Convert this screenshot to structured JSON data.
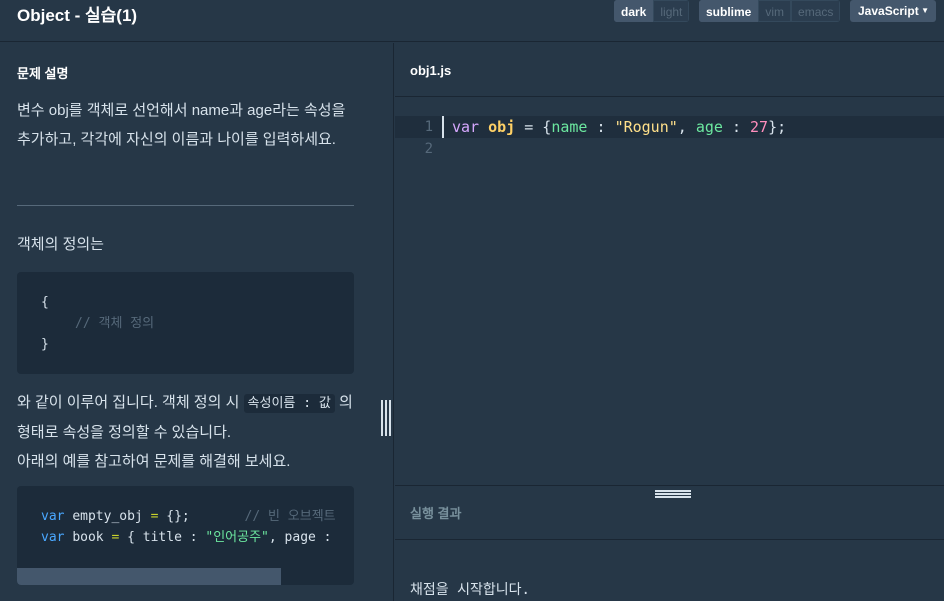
{
  "header": {
    "title": "Object - 실습(1)",
    "theme": [
      "dark",
      "light"
    ],
    "keymap": [
      "sublime",
      "vim",
      "emacs"
    ],
    "language": "JavaScript"
  },
  "problem": {
    "heading": "문제 설명",
    "description": "변수 obj를 객체로 선언해서 name과 age라는 속성을 추가하고, 각각에 자신의 이름과 나이를 입력하세요.",
    "definition_intro": "객체의 정의는",
    "code1": {
      "open": "{",
      "comment": "// 객체 정의",
      "close": "}"
    },
    "p2_prefix": "와 같이 이루어 집니다. 객체 정의 시",
    "p2_code": "속성이름 : 값",
    "p2_suffix": "의 형태로 속성을 정의할 수 있습니다.",
    "p2_line3": "아래의 예를 참고하여 문제를 해결해 보세요.",
    "code2": {
      "line1_kw": "var",
      "line1_name": "empty_obj",
      "line1_op": "=",
      "line1_val": "{};",
      "line1_comment": "// 빈 오브젝트",
      "line2_kw": "var",
      "line2_name": "book",
      "line2_op": "=",
      "line2_open": "{ title :",
      "line2_str": "\"인어공주\"",
      "line2_rest": ", page :"
    }
  },
  "editor": {
    "file_tab": "obj1.js",
    "line_numbers": [
      "1",
      "2"
    ],
    "line1": {
      "kw": "var",
      "id": "obj",
      "eq": " = {",
      "prop1": "name",
      "colon1": " : ",
      "str": "\"Rogun\"",
      "comma": ", ",
      "prop2": "age",
      "colon2": " : ",
      "num": "27",
      "end": "};"
    }
  },
  "result": {
    "title": "실행 결과",
    "body": "채점을 시작합니다."
  }
}
